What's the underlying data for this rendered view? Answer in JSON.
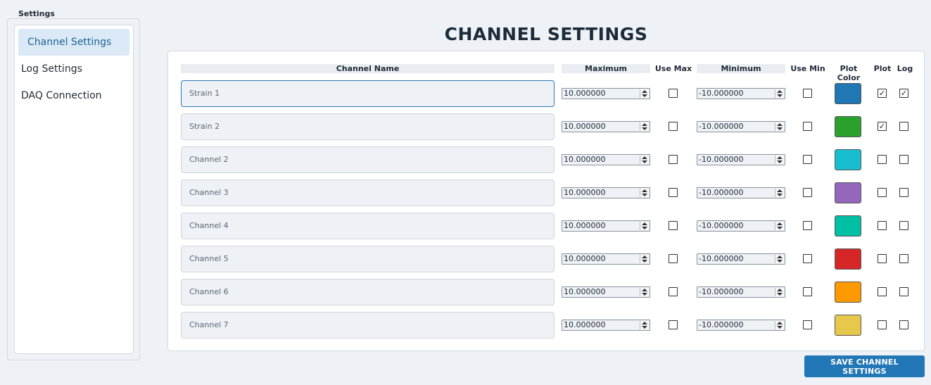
{
  "sidebar": {
    "group_title": "Settings",
    "items": [
      {
        "label": "Channel Settings",
        "active": true
      },
      {
        "label": "Log Settings",
        "active": false
      },
      {
        "label": "DAQ Connection",
        "active": false
      }
    ]
  },
  "main": {
    "title": "CHANNEL SETTINGS",
    "headers": {
      "name": "Channel Name",
      "max": "Maximum",
      "use_max": "Use Max",
      "min": "Minimum",
      "use_min": "Use Min",
      "color": "Plot Color",
      "plot": "Plot",
      "log": "Log"
    },
    "channels": [
      {
        "name": "Strain 1",
        "max": "10.000000",
        "use_max": false,
        "min": "-10.000000",
        "use_min": false,
        "color": "#1f77b4",
        "plot": true,
        "log": true
      },
      {
        "name": "Strain 2",
        "max": "10.000000",
        "use_max": false,
        "min": "-10.000000",
        "use_min": false,
        "color": "#2ca02c",
        "plot": true,
        "log": false
      },
      {
        "name": "Channel 2",
        "max": "10.000000",
        "use_max": false,
        "min": "-10.000000",
        "use_min": false,
        "color": "#17becf",
        "plot": false,
        "log": false
      },
      {
        "name": "Channel 3",
        "max": "10.000000",
        "use_max": false,
        "min": "-10.000000",
        "use_min": false,
        "color": "#9467bd",
        "plot": false,
        "log": false
      },
      {
        "name": "Channel 4",
        "max": "10.000000",
        "use_max": false,
        "min": "-10.000000",
        "use_min": false,
        "color": "#00bfa5",
        "plot": false,
        "log": false
      },
      {
        "name": "Channel 5",
        "max": "10.000000",
        "use_max": false,
        "min": "-10.000000",
        "use_min": false,
        "color": "#d62728",
        "plot": false,
        "log": false
      },
      {
        "name": "Channel 6",
        "max": "10.000000",
        "use_max": false,
        "min": "-10.000000",
        "use_min": false,
        "color": "#ff9900",
        "plot": false,
        "log": false
      },
      {
        "name": "Channel 7",
        "max": "10.000000",
        "use_max": false,
        "min": "-10.000000",
        "use_min": false,
        "color": "#e6c84c",
        "plot": false,
        "log": false
      }
    ],
    "save_label": "SAVE CHANNEL SETTINGS"
  }
}
